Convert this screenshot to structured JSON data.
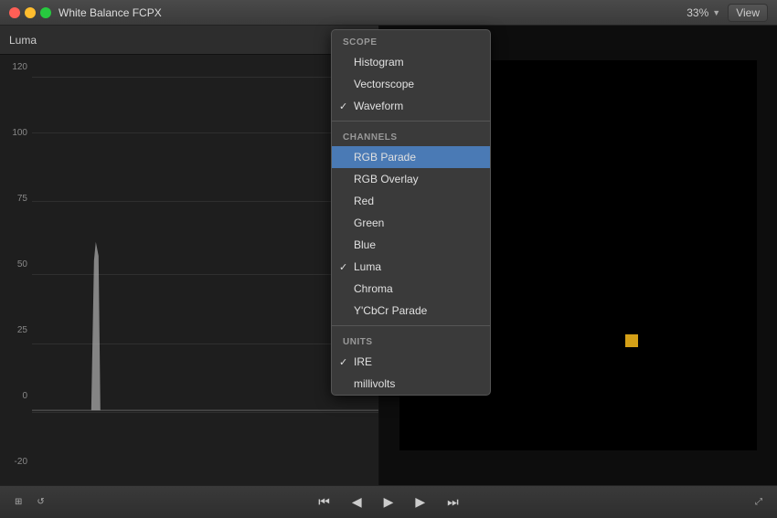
{
  "titleBar": {
    "title": "White Balance FCPX",
    "zoom": "33%",
    "viewLabel": "View"
  },
  "waveformPanel": {
    "label": "Luma",
    "yAxis": [
      "120",
      "100",
      "75",
      "50",
      "25",
      "0",
      "-20"
    ]
  },
  "dropdown": {
    "scopeHeader": "SCOPE",
    "items_scope": [
      "Histogram",
      "Vectorscope",
      "Waveform"
    ],
    "waveformChecked": true,
    "channelsHeader": "CHANNELS",
    "items_channels": [
      "RGB Parade",
      "RGB Overlay",
      "Red",
      "Green",
      "Blue",
      "Luma",
      "Chroma",
      "Y'CbCr Parade"
    ],
    "lumaChecked": true,
    "activeItem": "RGB Parade",
    "unitsHeader": "UNITS",
    "items_units": [
      "IRE",
      "millivolts"
    ],
    "ireChecked": true
  },
  "bottomToolbar": {
    "prevLabel": "◀",
    "playLabel": "▶",
    "nextLabel": "▶▶",
    "skipBackLabel": "◀◀",
    "skipFwdLabel": "▶▶"
  },
  "icons": {
    "gear": "⚙",
    "check": "✓",
    "dropdownArrow": "▼",
    "filmIcon": "🎬"
  }
}
